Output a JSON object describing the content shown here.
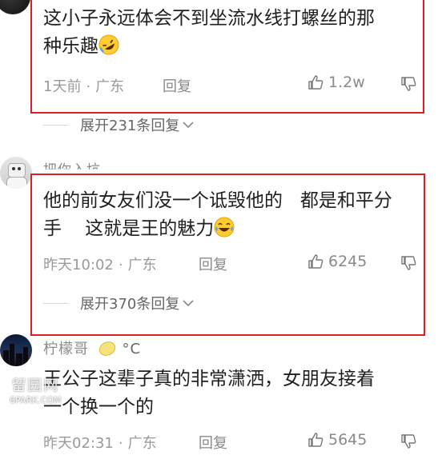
{
  "comments": [
    {
      "lines": [
        "这小子永远体会不到坐流水线打螺丝的那",
        "种乐趣"
      ],
      "emoji": "laughing-rolling-emoji",
      "time": "1天前",
      "location": "广东",
      "reply_label": "回复",
      "likes": "1.2w",
      "expand_label": "展开231条回复"
    },
    {
      "username": "把你入坑",
      "lines": [
        "他的前女友们没一个诋毁他的   都是和平分",
        "手    这就是王的魅力"
      ],
      "emoji": "tears-of-joy-emoji",
      "time": "昨天10:02",
      "location": "广东",
      "reply_label": "回复",
      "likes": "6245",
      "expand_label": "展开370条回复"
    },
    {
      "username": "柠檬哥",
      "username_suffix": "°C",
      "lines": [
        "王公子这辈子真的非常潇洒，女朋友接着",
        "一个换一个的"
      ],
      "time": "昨天02:31",
      "location": "广东",
      "reply_label": "回复",
      "likes": "5645"
    }
  ],
  "separator": "·",
  "watermark": {
    "line1": "留园网",
    "line2": "6PARK.COM"
  },
  "colors": {
    "highlight_box": "#e31b23",
    "meta": "#9a9a9a"
  }
}
